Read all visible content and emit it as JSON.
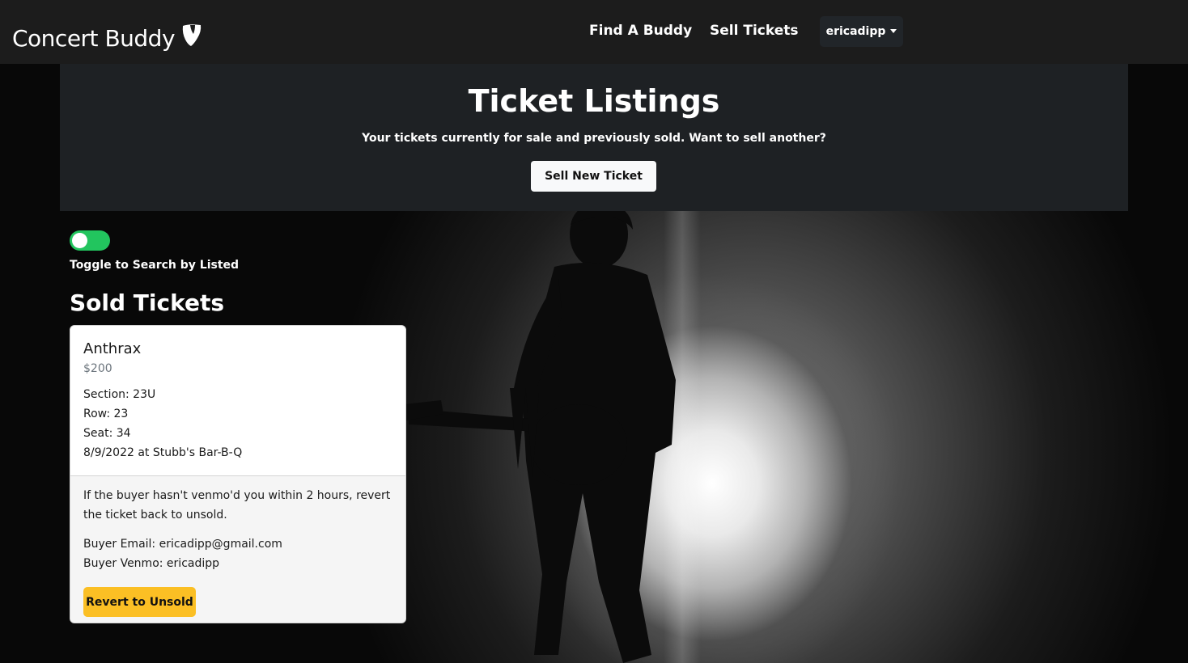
{
  "navbar": {
    "brand": "Concert Buddy",
    "brand_icon": "typo3-logo-icon",
    "links": [
      "Find A Buddy",
      "Sell Tickets"
    ],
    "user": "ericadipp"
  },
  "hero": {
    "title": "Ticket Listings",
    "subtitle": "Your tickets currently for sale and previously sold. Want to sell another?",
    "sell_button": "Sell New Ticket"
  },
  "toggle": {
    "label": "Toggle to Search by Listed",
    "on": true,
    "color": "#22c55e"
  },
  "section_title": "Sold Tickets",
  "ticket": {
    "artist": "Anthrax",
    "price": "$200",
    "section": "Section: 23U",
    "row": "Row: 23",
    "seat": "Seat: 34",
    "date_venue": "8/9/2022 at Stubb's Bar-B-Q",
    "note": "If the buyer hasn't venmo'd you within 2 hours, revert the ticket back to unsold.",
    "buyer_email": "Buyer Email: ericadipp@gmail.com",
    "buyer_venmo": "Buyer Venmo: ericadipp",
    "revert_button": "Revert to Unsold"
  },
  "colors": {
    "navbar": "#1c1c1c",
    "hero": "#1e2124",
    "revert_button": "#fbbf24"
  }
}
